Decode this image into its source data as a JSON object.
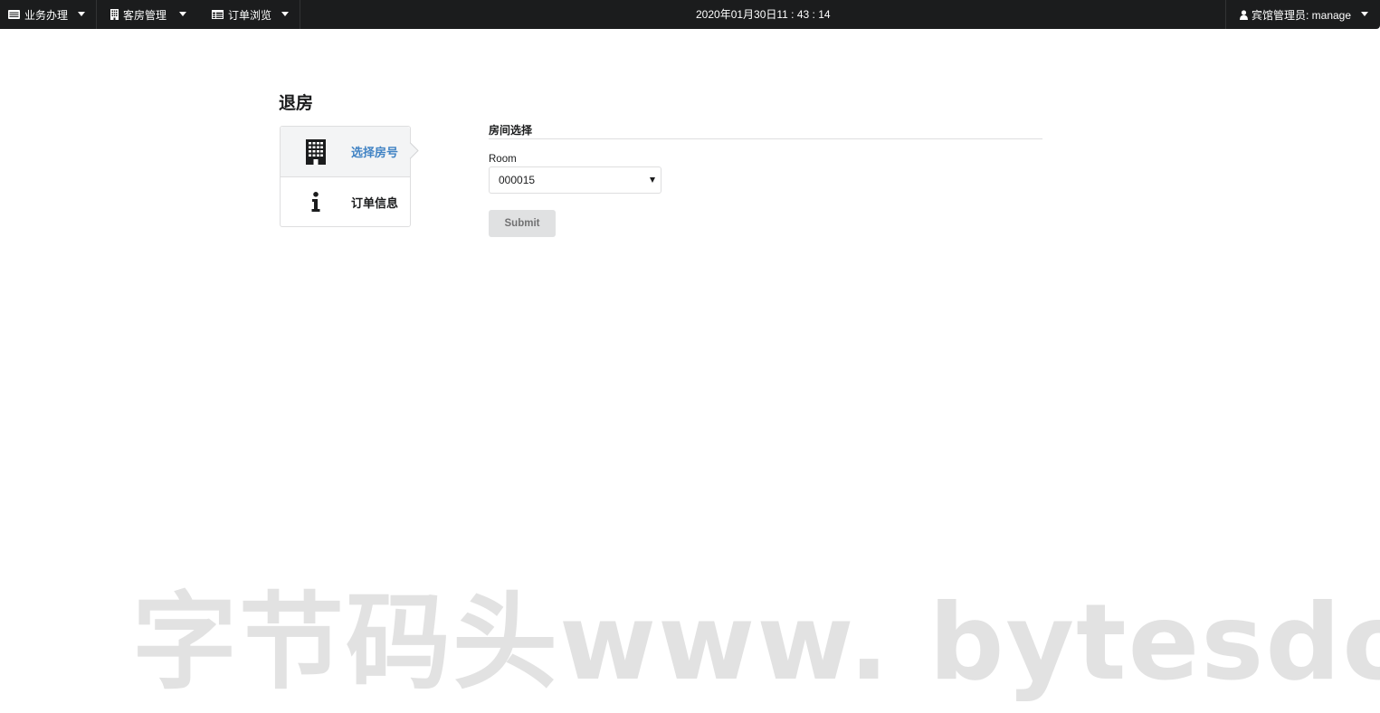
{
  "topbar": {
    "menus": [
      {
        "label": "业务办理",
        "icon": "list-icon"
      },
      {
        "label": "客房管理",
        "icon": "building-icon"
      },
      {
        "label": "订单浏览",
        "icon": "table-icon"
      }
    ],
    "datetime": "2020年01月30日11 : 43 : 14",
    "user": {
      "label": "宾馆管理员: manage",
      "icon": "user-icon"
    }
  },
  "page": {
    "title": "退房",
    "steps": [
      {
        "label": "选择房号",
        "icon": "building-icon",
        "active": true
      },
      {
        "label": "订单信息",
        "icon": "info-icon",
        "active": false
      }
    ]
  },
  "form": {
    "section_title": "房间选择",
    "room_label": "Room",
    "room_value": "000015",
    "submit_label": "Submit"
  },
  "watermark": "字节码头www. bytesdock.",
  "colors": {
    "topbar_bg": "#1b1c1d",
    "active_step_text": "#4183c4",
    "submit_bg": "#e0e1e2",
    "watermark": "#e2e2e2"
  }
}
